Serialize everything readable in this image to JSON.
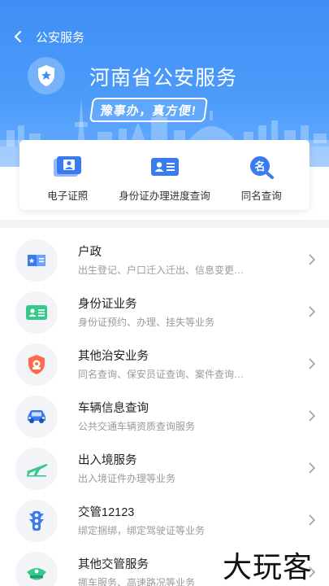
{
  "nav": {
    "back_icon": "chevron-left-icon",
    "title": "公安服务"
  },
  "hero": {
    "badge_icon": "police-badge-icon",
    "title": "河南省公安服务",
    "slogan": "豫事办，真方便!"
  },
  "quick": [
    {
      "icon": "id-card-photo-icon",
      "label": "电子证照"
    },
    {
      "icon": "id-card-icon",
      "label": "身份证办理进度查询"
    },
    {
      "icon": "name-search-icon",
      "label": "同名查询"
    }
  ],
  "services": [
    {
      "icon": "household-register-icon",
      "title": "户政",
      "subtitle": "出生登记、户口迁入迁出、信息变更…"
    },
    {
      "icon": "id-card-icon",
      "title": "身份证业务",
      "subtitle": "身份证预约、办理、挂失等业务"
    },
    {
      "icon": "security-shield-icon",
      "title": "其他治安业务",
      "subtitle": "同名查询、保安员证查询、案件查询…"
    },
    {
      "icon": "car-icon",
      "title": "车辆信息查询",
      "subtitle": "公共交通车辆资质查询服务"
    },
    {
      "icon": "airplane-icon",
      "title": "出入境服务",
      "subtitle": "出入境证件办理等业务"
    },
    {
      "icon": "traffic-light-icon",
      "title": "交管12123",
      "subtitle": "绑定捆绑，绑定驾驶证等业务"
    },
    {
      "icon": "police-cap-icon",
      "title": "其他交管服务",
      "subtitle": "挪车服务、高速路况等业务"
    }
  ],
  "watermark": "大玩客",
  "colors": {
    "primary": "#3f8ff5",
    "accent_orange": "#ff6b4a",
    "accent_green": "#36c98e"
  }
}
